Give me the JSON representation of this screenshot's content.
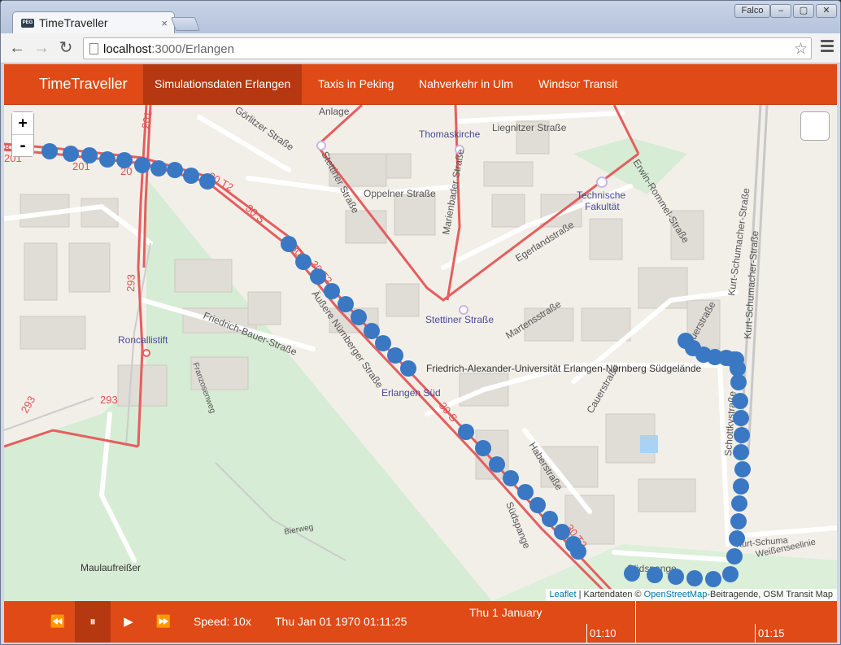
{
  "browser": {
    "tab_title": "TimeTraveller",
    "tab_close": "×",
    "favicon_text": "PEG",
    "profile_name": "Falco",
    "url_host": "localhost",
    "url_rest": ":3000/Erlangen",
    "minimize": "–",
    "maximize": "▢",
    "close": "✕"
  },
  "navbar": {
    "brand": "TimeTraveller",
    "links": [
      "Simulationsdaten Erlangen",
      "Taxis in Peking",
      "Nahverkehr in Ulm",
      "Windsor Transit"
    ],
    "active_index": 0,
    "color": "#df4a16",
    "active_color": "#b53810"
  },
  "map": {
    "zoom_in": "+",
    "zoom_out": "-",
    "attribution": {
      "leaflet": "Leaflet",
      "sep": " | Kartendaten © ",
      "osm": "OpenStreetMap",
      "rest": "-Beitragende, OSM Transit Map"
    },
    "labels": {
      "anlage": "Anlage",
      "thomaskirche": "Thomaskirche",
      "liegnitzer": "Liegnitzer Straße",
      "goerlitzer": "Görlitzer Straße",
      "stettiner_str_v": "Stettiner Straße",
      "oppelner": "Oppelner Straße",
      "marienbader": "Marienbader Straße",
      "technische": "Technische",
      "fakultaet": "Fakultät",
      "erwin": "Erwin-Rommel-Straße",
      "kurt1": "Kurt-Schumacher-Straße",
      "kurt2": "Kurt-Schumacher-Straße",
      "egerland": "Egerlandstraße",
      "stettiner_stop": "Stettiner Straße",
      "martens": "Martensstraße",
      "friedrich_bauer": "Friedrich-Bauer-Straße",
      "roncalli": "Roncallistift",
      "franzosenweg": "Franzosenweg",
      "aeussere": "Äußere Nürnberger Straße",
      "erlangen_sued": "Erlangen Süd",
      "fau": "Friedrich-Alexander-Universität Erlangen-Nürnberg Südgelände",
      "cauer": "Cauerstraße",
      "cauer_top": "auerstraße",
      "schottky": "Schottkystraße",
      "haber": "Haberstraße",
      "suedspange": "Südspange",
      "suedspange2": "Südspange",
      "weissensee": "Weißenseelinie",
      "bierweg": "Bierweg",
      "maulauf": "Maulaufreißer",
      "r201a": "201",
      "r201b": "201",
      "r201c": "201",
      "r20": "20",
      "r293a": "293",
      "r293b": "293",
      "r293c": "293",
      "r8": "8",
      "t30_1": "30 T2",
      "t30_2": "30 S",
      "t30_3": "30 S",
      "t30_4": "30 T2",
      "t30_5": "30 S",
      "t30_6": "30 T2",
      "schumacher_short": "Kurt-Schuma"
    },
    "vehicle_color": "#3a78c3"
  },
  "controls": {
    "rewind_icon": "⏪",
    "pause_icon": "⏸",
    "play_icon": "▶",
    "forward_icon": "⏩",
    "speed": "Speed: 10x",
    "datetime": "Thu Jan 01 1970 01:11:25",
    "timeline_day": "Thu 1 January",
    "tick1": "01:10",
    "tick2": "01:15"
  }
}
